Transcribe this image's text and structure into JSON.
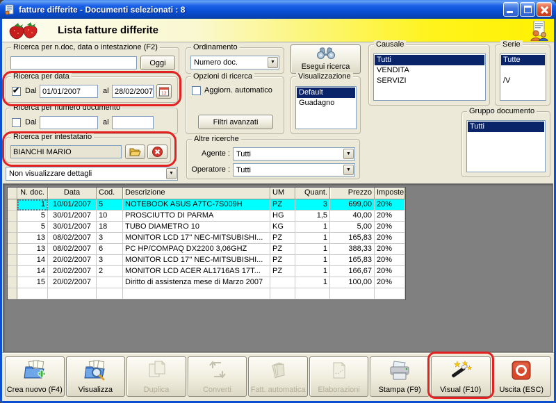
{
  "window": {
    "title": "fatture differite - Documenti selezionati : 8",
    "controls": {
      "minimize": "minimize",
      "maximize": "maximize",
      "close": "close"
    }
  },
  "header": {
    "title": "Lista fatture differite"
  },
  "filters": {
    "search_group": {
      "label": "Ricerca per n.doc, data o intestazione (F2)",
      "value": "",
      "today_button": "Oggi"
    },
    "date_group": {
      "label": "Ricerca per data",
      "dal_label": "Dal",
      "from": "01/01/2007",
      "al_label": "al",
      "to": "28/02/2007",
      "checked": true
    },
    "numdoc_group": {
      "label": "Ricerca per numero documento",
      "dal_label": "Dal",
      "al_label": "al",
      "from": "",
      "to": "",
      "checked": false
    },
    "intest_group": {
      "label": "Ricerca per intestatario",
      "value": "BIANCHI MARIO"
    },
    "details_combo": {
      "value": "Non visualizzare dettagli"
    },
    "ordinamento": {
      "label": "Ordinamento",
      "value": "Numero doc."
    },
    "opzioni": {
      "label": "Opzioni di ricerca",
      "auto_label": "Aggiorn. automatico",
      "auto_checked": false,
      "advanced_button": "Filtri avanzati"
    },
    "esegui_button": "Esegui ricerca",
    "visualizzazione": {
      "label": "Visualizzazione",
      "items": [
        "Default",
        "Guadagno"
      ],
      "selected": 0
    },
    "causale": {
      "label": "Causale",
      "items": [
        "Tutti",
        "VENDITA",
        "SERVIZI"
      ],
      "selected": 0
    },
    "serie": {
      "label": "Serie",
      "items": [
        "Tutte",
        "",
        "/V"
      ],
      "selected": 0
    },
    "gruppo": {
      "label": "Gruppo documento",
      "items": [
        "Tutti"
      ],
      "selected": 0
    },
    "altre": {
      "label": "Altre ricerche",
      "agente_label": "Agente :",
      "agente_value": "Tutti",
      "operatore_label": "Operatore :",
      "operatore_value": "Tutti"
    }
  },
  "table": {
    "columns": [
      "N. doc.",
      "Data",
      "Cod.",
      "Descrizione",
      "UM",
      "Quant.",
      "Prezzo",
      "Imposte"
    ],
    "selected_row": 0,
    "rows": [
      [
        "1",
        "10/01/2007",
        "5",
        "NOTEBOOK ASUS A7TC-7S009H",
        "PZ",
        "3",
        "699,00",
        "20%"
      ],
      [
        "5",
        "30/01/2007",
        "10",
        "PROSCIUTTO DI PARMA",
        "HG",
        "1,5",
        "40,00",
        "20%"
      ],
      [
        "5",
        "30/01/2007",
        "18",
        "TUBO DIAMETRO 10",
        "KG",
        "1",
        "5,00",
        "20%"
      ],
      [
        "13",
        "08/02/2007",
        "3",
        "MONITOR LCD 17'' NEC-MITSUBISHI...",
        "PZ",
        "1",
        "165,83",
        "20%"
      ],
      [
        "13",
        "08/02/2007",
        "6",
        "PC HP/COMPAQ DX2200 3,06GHZ",
        "PZ",
        "1",
        "388,33",
        "20%"
      ],
      [
        "14",
        "20/02/2007",
        "3",
        "MONITOR LCD 17'' NEC-MITSUBISHI...",
        "PZ",
        "1",
        "165,83",
        "20%"
      ],
      [
        "14",
        "20/02/2007",
        "2",
        "MONITOR LCD ACER AL1716AS 17T...",
        "PZ",
        "1",
        "166,67",
        "20%"
      ],
      [
        "15",
        "20/02/2007",
        "",
        "Diritto di assistenza mese di Marzo 2007",
        "",
        "1",
        "100,00",
        "20%"
      ]
    ]
  },
  "toolbar": {
    "buttons": [
      {
        "label": "Crea nuovo (F4)",
        "enabled": true,
        "icon": "folder-plus-icon"
      },
      {
        "label": "Visualizza",
        "enabled": true,
        "icon": "folder-search-icon"
      },
      {
        "label": "Duplica",
        "enabled": false,
        "icon": "copy-pages-icon"
      },
      {
        "label": "Converti",
        "enabled": false,
        "icon": "convert-arrows-icon"
      },
      {
        "label": "Fatt. automatica",
        "enabled": false,
        "icon": "stack-icon"
      },
      {
        "label": "Elaborazioni",
        "enabled": false,
        "icon": "process-page-icon"
      },
      {
        "label": "Stampa (F9)",
        "enabled": true,
        "icon": "printer-icon"
      },
      {
        "label": "Visual (F10)",
        "enabled": true,
        "icon": "magic-wand-icon"
      },
      {
        "label": "Uscita (ESC)",
        "enabled": true,
        "icon": "power-icon"
      }
    ]
  },
  "colors": {
    "annotation_red": "#E32121",
    "selection_navy": "#0A246A",
    "selected_row_cyan": "#00FFFF",
    "band_yellow": "#FFF200",
    "titlebar_blue": "#0A4ED2"
  }
}
